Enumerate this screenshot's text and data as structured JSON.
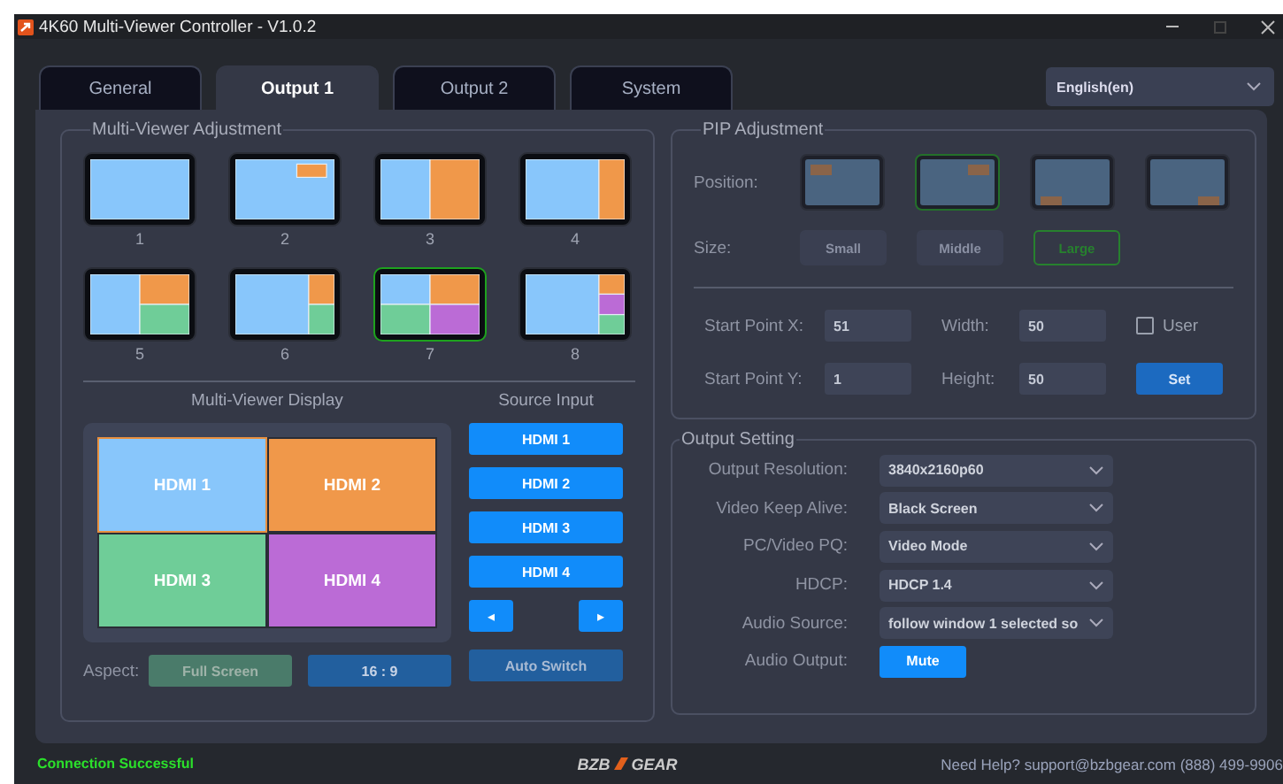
{
  "window": {
    "title": "4K60 Multi-Viewer Controller - V1.0.2"
  },
  "tabs": [
    {
      "label": "General",
      "selected": false
    },
    {
      "label": "Output 1",
      "selected": true
    },
    {
      "label": "Output 2",
      "selected": false
    },
    {
      "label": "System",
      "selected": false
    }
  ],
  "language": {
    "value": "English(en)"
  },
  "multiviewer": {
    "title": "Multi-Viewer Adjustment",
    "layouts": [
      {
        "label": "1",
        "kind": "full",
        "selected": false
      },
      {
        "label": "2",
        "kind": "pip",
        "selected": false
      },
      {
        "label": "3",
        "kind": "half",
        "selected": false
      },
      {
        "label": "4",
        "kind": "wide",
        "selected": false
      },
      {
        "label": "5",
        "kind": "tri",
        "selected": false
      },
      {
        "label": "6",
        "kind": "triwide",
        "selected": false
      },
      {
        "label": "7",
        "kind": "quad",
        "selected": true
      },
      {
        "label": "8",
        "kind": "side",
        "selected": false
      }
    ],
    "display_title": "Multi-Viewer Display",
    "windows": [
      {
        "label": "HDMI 1",
        "color": "#88c6fb",
        "selected": true
      },
      {
        "label": "HDMI 2",
        "color": "#f0984a",
        "selected": false
      },
      {
        "label": "HDMI 3",
        "color": "#6fcd98",
        "selected": false
      },
      {
        "label": "HDMI 4",
        "color": "#bb6bd6",
        "selected": false
      }
    ],
    "source_title": "Source Input",
    "sources": [
      {
        "label": "HDMI 1"
      },
      {
        "label": "HDMI 2"
      },
      {
        "label": "HDMI 3"
      },
      {
        "label": "HDMI 4"
      }
    ],
    "prev": "◂",
    "next": "▸",
    "aspect_label": "Aspect:",
    "aspects": [
      {
        "label": "Full Screen",
        "selected": true
      },
      {
        "label": "16 : 9",
        "selected": false
      }
    ],
    "auto_switch": "Auto Switch"
  },
  "pip": {
    "title": "PIP Adjustment",
    "position_label": "Position:",
    "positions": [
      {
        "kind": "topleft",
        "selected": false
      },
      {
        "kind": "topright",
        "selected": true
      },
      {
        "kind": "bottomleft",
        "selected": false
      },
      {
        "kind": "bottomright",
        "selected": false
      }
    ],
    "size_label": "Size:",
    "sizes": [
      {
        "label": "Small",
        "selected": false
      },
      {
        "label": "Middle",
        "selected": false
      },
      {
        "label": "Large",
        "selected": true
      }
    ],
    "fields": [
      {
        "label": "Start Point X:",
        "value": "51"
      },
      {
        "label": "Width:",
        "value": "50"
      },
      {
        "label": "Start Point Y:",
        "value": "1"
      },
      {
        "label": "Height:",
        "value": "50"
      }
    ],
    "user": {
      "label": "User",
      "checked": false
    },
    "set": "Set"
  },
  "output": {
    "title": "Output Setting",
    "rows": [
      {
        "label": "Output Resolution:",
        "kind": "select",
        "value": "3840x2160p60"
      },
      {
        "label": "Video Keep Alive:",
        "kind": "select",
        "value": "Black Screen"
      },
      {
        "label": "PC/Video PQ:",
        "kind": "select",
        "value": "Video Mode"
      },
      {
        "label": "HDCP:",
        "kind": "select",
        "value": "HDCP 1.4"
      },
      {
        "label": "Audio Source:",
        "kind": "select",
        "value": "follow window 1 selected so"
      },
      {
        "label": "Audio Output:",
        "kind": "button",
        "value": "Mute"
      }
    ]
  },
  "status_bar": {
    "status": "Connection Successful",
    "logo_left": "BZB",
    "logo_right": "GEAR",
    "help": "Need Help? support@bzbgear.com (888) 499-9906"
  }
}
